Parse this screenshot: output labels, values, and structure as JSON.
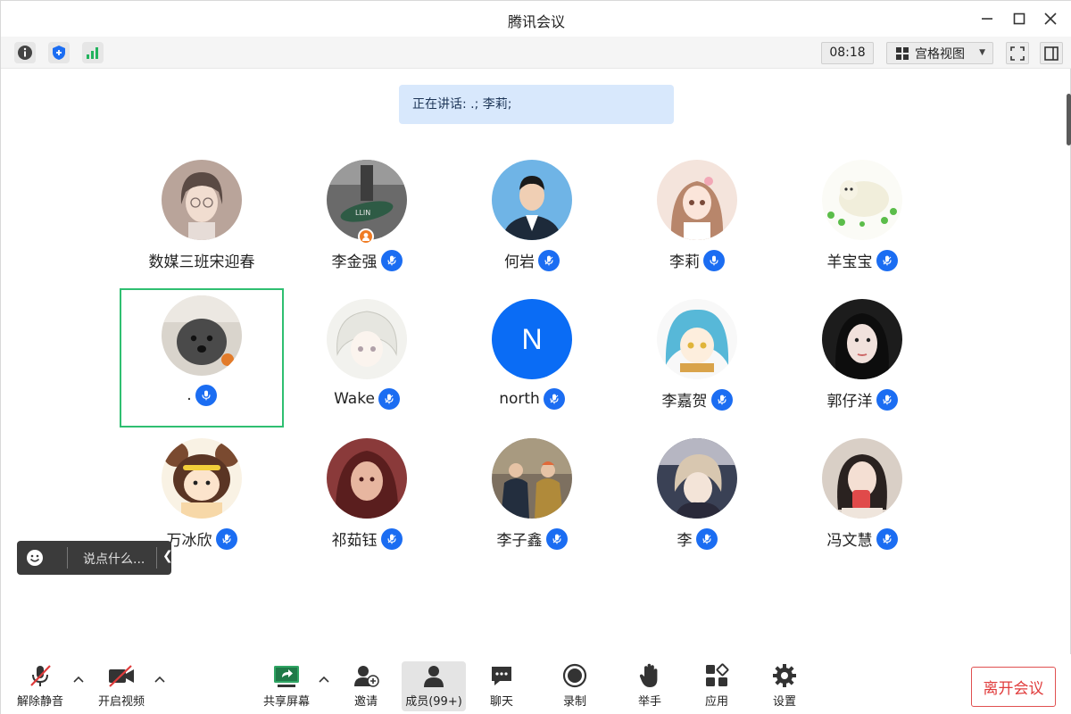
{
  "window": {
    "title": "腾讯会议"
  },
  "toolbar": {
    "time": "08:18",
    "view_label": "宫格视图",
    "icons": [
      "info-icon",
      "shield-icon",
      "signal-icon",
      "fullscreen-icon",
      "sidebar-icon"
    ]
  },
  "speaking": {
    "label": "正在讲话: .; 李莉;"
  },
  "participants": [
    {
      "name": "数媒三班宋迎春",
      "mic": false,
      "host": false,
      "avatar": "drawn-girl"
    },
    {
      "name": "李金强",
      "mic": "muted",
      "host": true,
      "avatar": "skate"
    },
    {
      "name": "何岩",
      "mic": "muted",
      "host": false,
      "avatar": "man-suit"
    },
    {
      "name": "李莉",
      "mic": "active",
      "host": false,
      "avatar": "anime-girl"
    },
    {
      "name": "羊宝宝",
      "mic": "muted",
      "host": false,
      "avatar": "sheep"
    },
    {
      "name": ".",
      "mic": "active",
      "host": false,
      "avatar": "dog",
      "selected": true
    },
    {
      "name": "Wake",
      "mic": "muted",
      "host": false,
      "avatar": "white-hair"
    },
    {
      "name": "north",
      "mic": "muted",
      "host": false,
      "avatar": "letter",
      "letter": "N"
    },
    {
      "name": "李嘉贺",
      "mic": "muted",
      "host": false,
      "avatar": "blue-hair"
    },
    {
      "name": "郭仔洋",
      "mic": "muted",
      "host": false,
      "avatar": "dark-girl"
    },
    {
      "name": "万冰欣",
      "mic": "muted",
      "host": false,
      "avatar": "cartoon-bear"
    },
    {
      "name": "祁茹钰",
      "mic": "muted",
      "host": false,
      "avatar": "red-art"
    },
    {
      "name": "李子鑫",
      "mic": "muted",
      "host": false,
      "avatar": "two-men"
    },
    {
      "name": "李",
      "mic": "muted",
      "host": false,
      "avatar": "anime-boy"
    },
    {
      "name": "冯文慧",
      "mic": "muted",
      "host": false,
      "avatar": "girl-photo"
    }
  ],
  "chat": {
    "prompt": "说点什么..."
  },
  "bottom": {
    "unmute": "解除静音",
    "video": "开启视频",
    "share": "共享屏幕",
    "invite": "邀请",
    "members": "成员(99+)",
    "chat": "聊天",
    "record": "录制",
    "raise_hand": "举手",
    "apps": "应用",
    "settings": "设置",
    "leave": "离开会议"
  },
  "colors": {
    "accent": "#1b6df2",
    "leave": "#e03c3c",
    "selected_border": "#2fbf71",
    "speaking_bg": "#d8e8fc"
  }
}
